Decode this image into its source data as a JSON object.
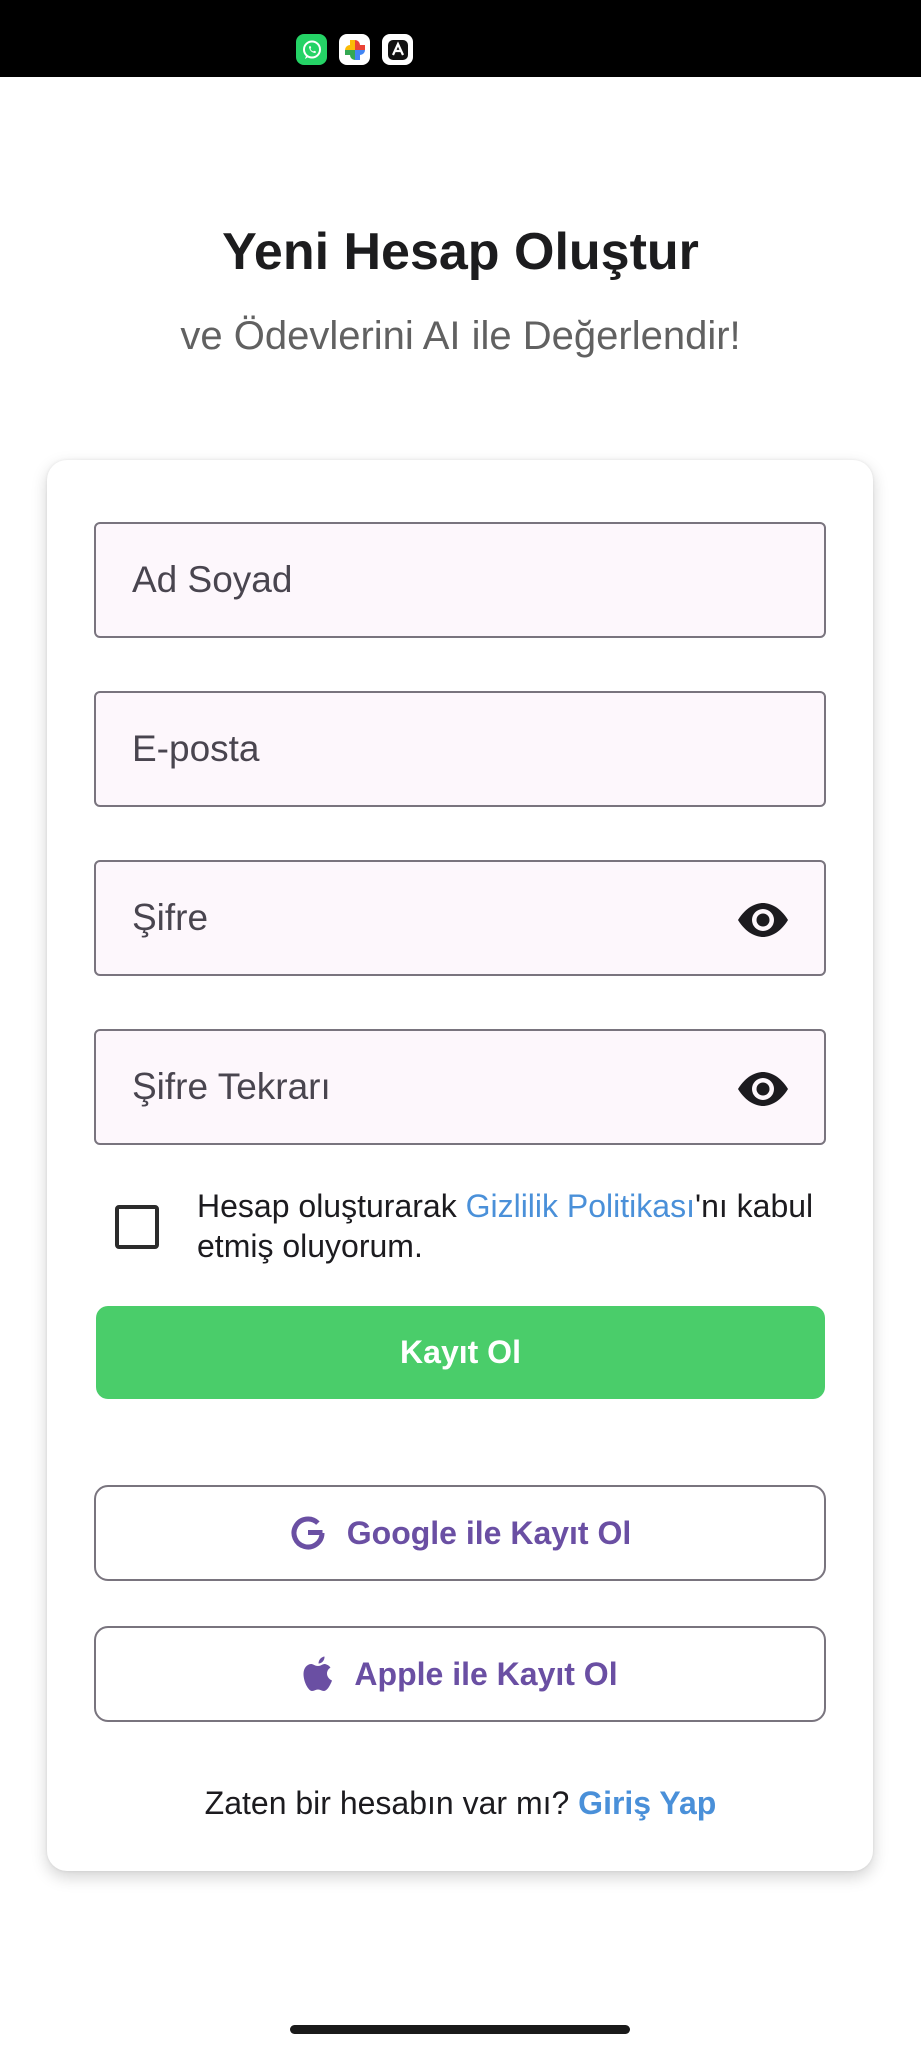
{
  "status_bar": {
    "icons": [
      "whatsapp-icon",
      "google-photos-icon",
      "cs-app-icon"
    ]
  },
  "header": {
    "title": "Yeni Hesap Oluştur",
    "subtitle": "ve Ödevlerini AI ile Değerlendir!"
  },
  "form": {
    "name_placeholder": "Ad Soyad",
    "email_placeholder": "E-posta",
    "password_placeholder": "Şifre",
    "password_confirm_placeholder": "Şifre Tekrarı",
    "password_toggle_icon": "eye-icon",
    "consent_prefix": "Hesap oluşturarak ",
    "consent_link": "Gizlilik Politikası",
    "consent_suffix": "'nı kabul etmiş oluyorum.",
    "consent_checked": false,
    "submit_label": "Kayıt Ol"
  },
  "social": {
    "google_label": "Google ile Kayıt Ol",
    "apple_label": "Apple ile Kayıt Ol"
  },
  "footer": {
    "prompt": "Zaten bir hesabın var mı? ",
    "login_link": "Giriş Yap"
  },
  "colors": {
    "primary_button": "#4acd6a",
    "link": "#4a90d9",
    "social_text": "#6a4fa3",
    "field_background": "#fdf7fc"
  }
}
